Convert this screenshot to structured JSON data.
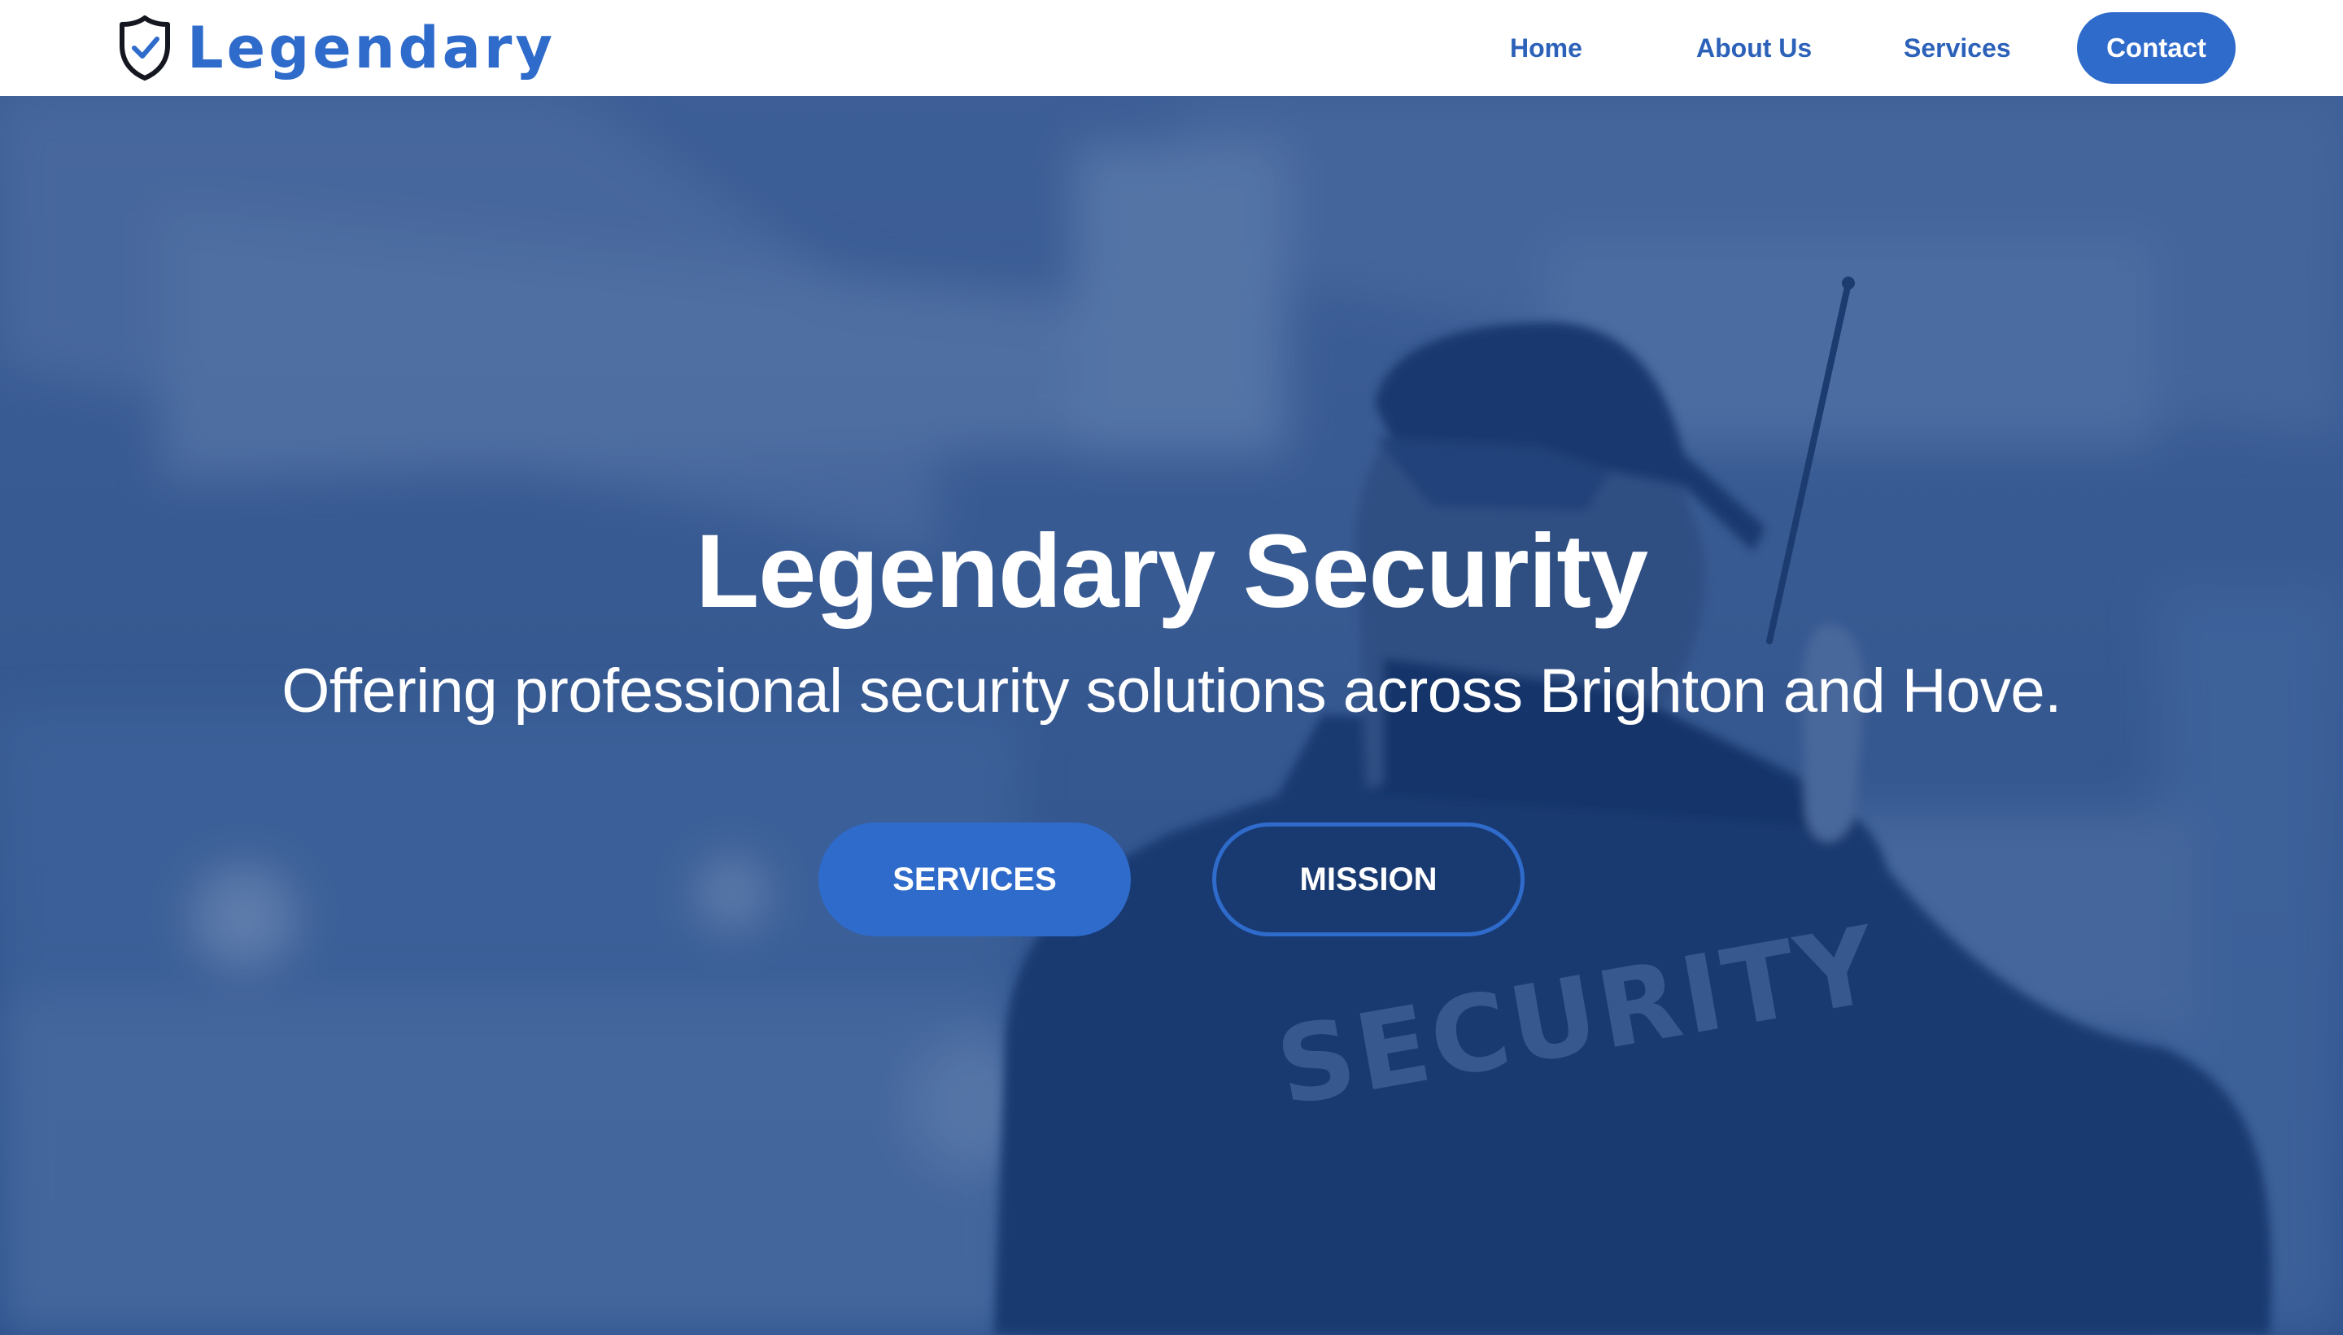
{
  "nav": {
    "brand_name": "Legendary",
    "brand_icon": "shield-check-icon",
    "links": [
      {
        "label": "Home"
      },
      {
        "label": "About Us"
      },
      {
        "label": "Services"
      }
    ],
    "contact_label": "Contact"
  },
  "hero": {
    "title": "Legendary Security",
    "subtitle": "Offering professional security solutions across Brighton and Hove.",
    "primary_button": "SERVICES",
    "secondary_button": "MISSION",
    "jacket_text": "SECURITY"
  },
  "colors": {
    "brand_blue": "#2f6bcb",
    "nav_link_blue": "#2c61b9",
    "overlay_blue": "#163e80",
    "text_white": "#ffffff"
  }
}
